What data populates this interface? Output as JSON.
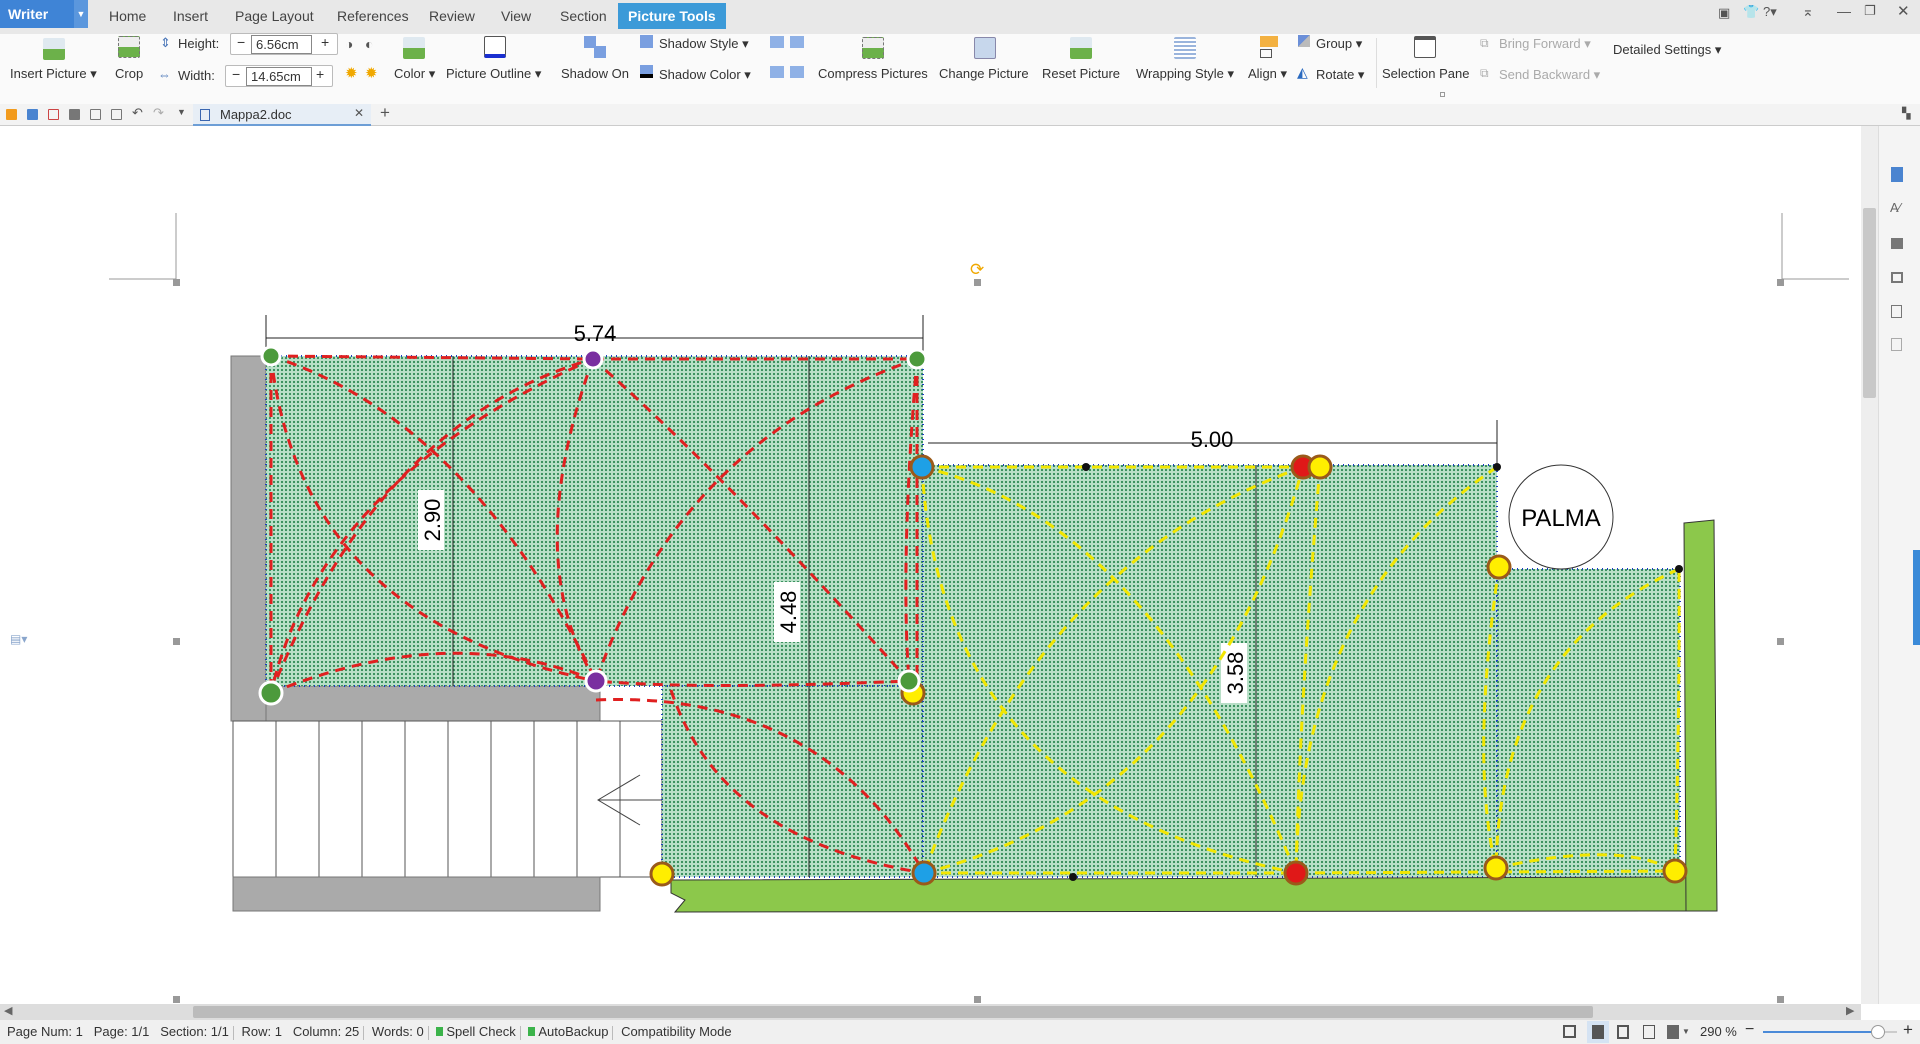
{
  "app": {
    "name": "Writer"
  },
  "menu_tabs": [
    "Home",
    "Insert",
    "Page Layout",
    "References",
    "Review",
    "View",
    "Section",
    "Picture Tools"
  ],
  "ribbon": {
    "insert_picture": "Insert Picture",
    "crop": "Crop",
    "height_label": "Height:",
    "height_value": "6.56cm",
    "width_label": "Width:",
    "width_value": "14.65cm",
    "color": "Color",
    "picture_outline": "Picture Outline",
    "shadow_on": "Shadow On",
    "shadow_style": "Shadow Style",
    "shadow_color": "Shadow Color",
    "compress_pictures": "Compress Pictures",
    "change_picture": "Change Picture",
    "reset_picture": "Reset Picture",
    "wrapping_style": "Wrapping Style",
    "align": "Align",
    "group": "Group",
    "rotate": "Rotate",
    "selection_pane": "Selection Pane",
    "bring_forward": "Bring Forward",
    "send_backward": "Send Backward",
    "detailed_settings": "Detailed Settings"
  },
  "document_tab": {
    "title": "Mappa2.doc"
  },
  "drawing": {
    "dimensions": {
      "top_width": "5.74",
      "right_width": "5.00",
      "left_height": "2.90",
      "middle_height": "4.48",
      "right_height": "3.58"
    },
    "palm_label": "PALMA",
    "colors": {
      "lawn": "#5aa97a",
      "hedge": "#8cc84b",
      "wall": "#aaaaaa",
      "zone1_arcs": "#e02020",
      "zone2_arcs": "#f2e600",
      "sprinkler_yellow": "#ffee00",
      "sprinkler_red": "#e01818",
      "sprinkler_blue": "#1ea0e6",
      "sprinkler_green": "#4c9a3c",
      "sprinkler_purple": "#7a2fa0"
    }
  },
  "status": {
    "page_num": "Page Num: 1",
    "page": "Page: 1/1",
    "section": "Section: 1/1",
    "row": "Row: 1",
    "column": "Column: 25",
    "words": "Words: 0",
    "spell_check": "Spell Check",
    "autobackup": "AutoBackup",
    "compat": "Compatibility Mode",
    "zoom": "290 %",
    "zoom_percent": 290
  }
}
